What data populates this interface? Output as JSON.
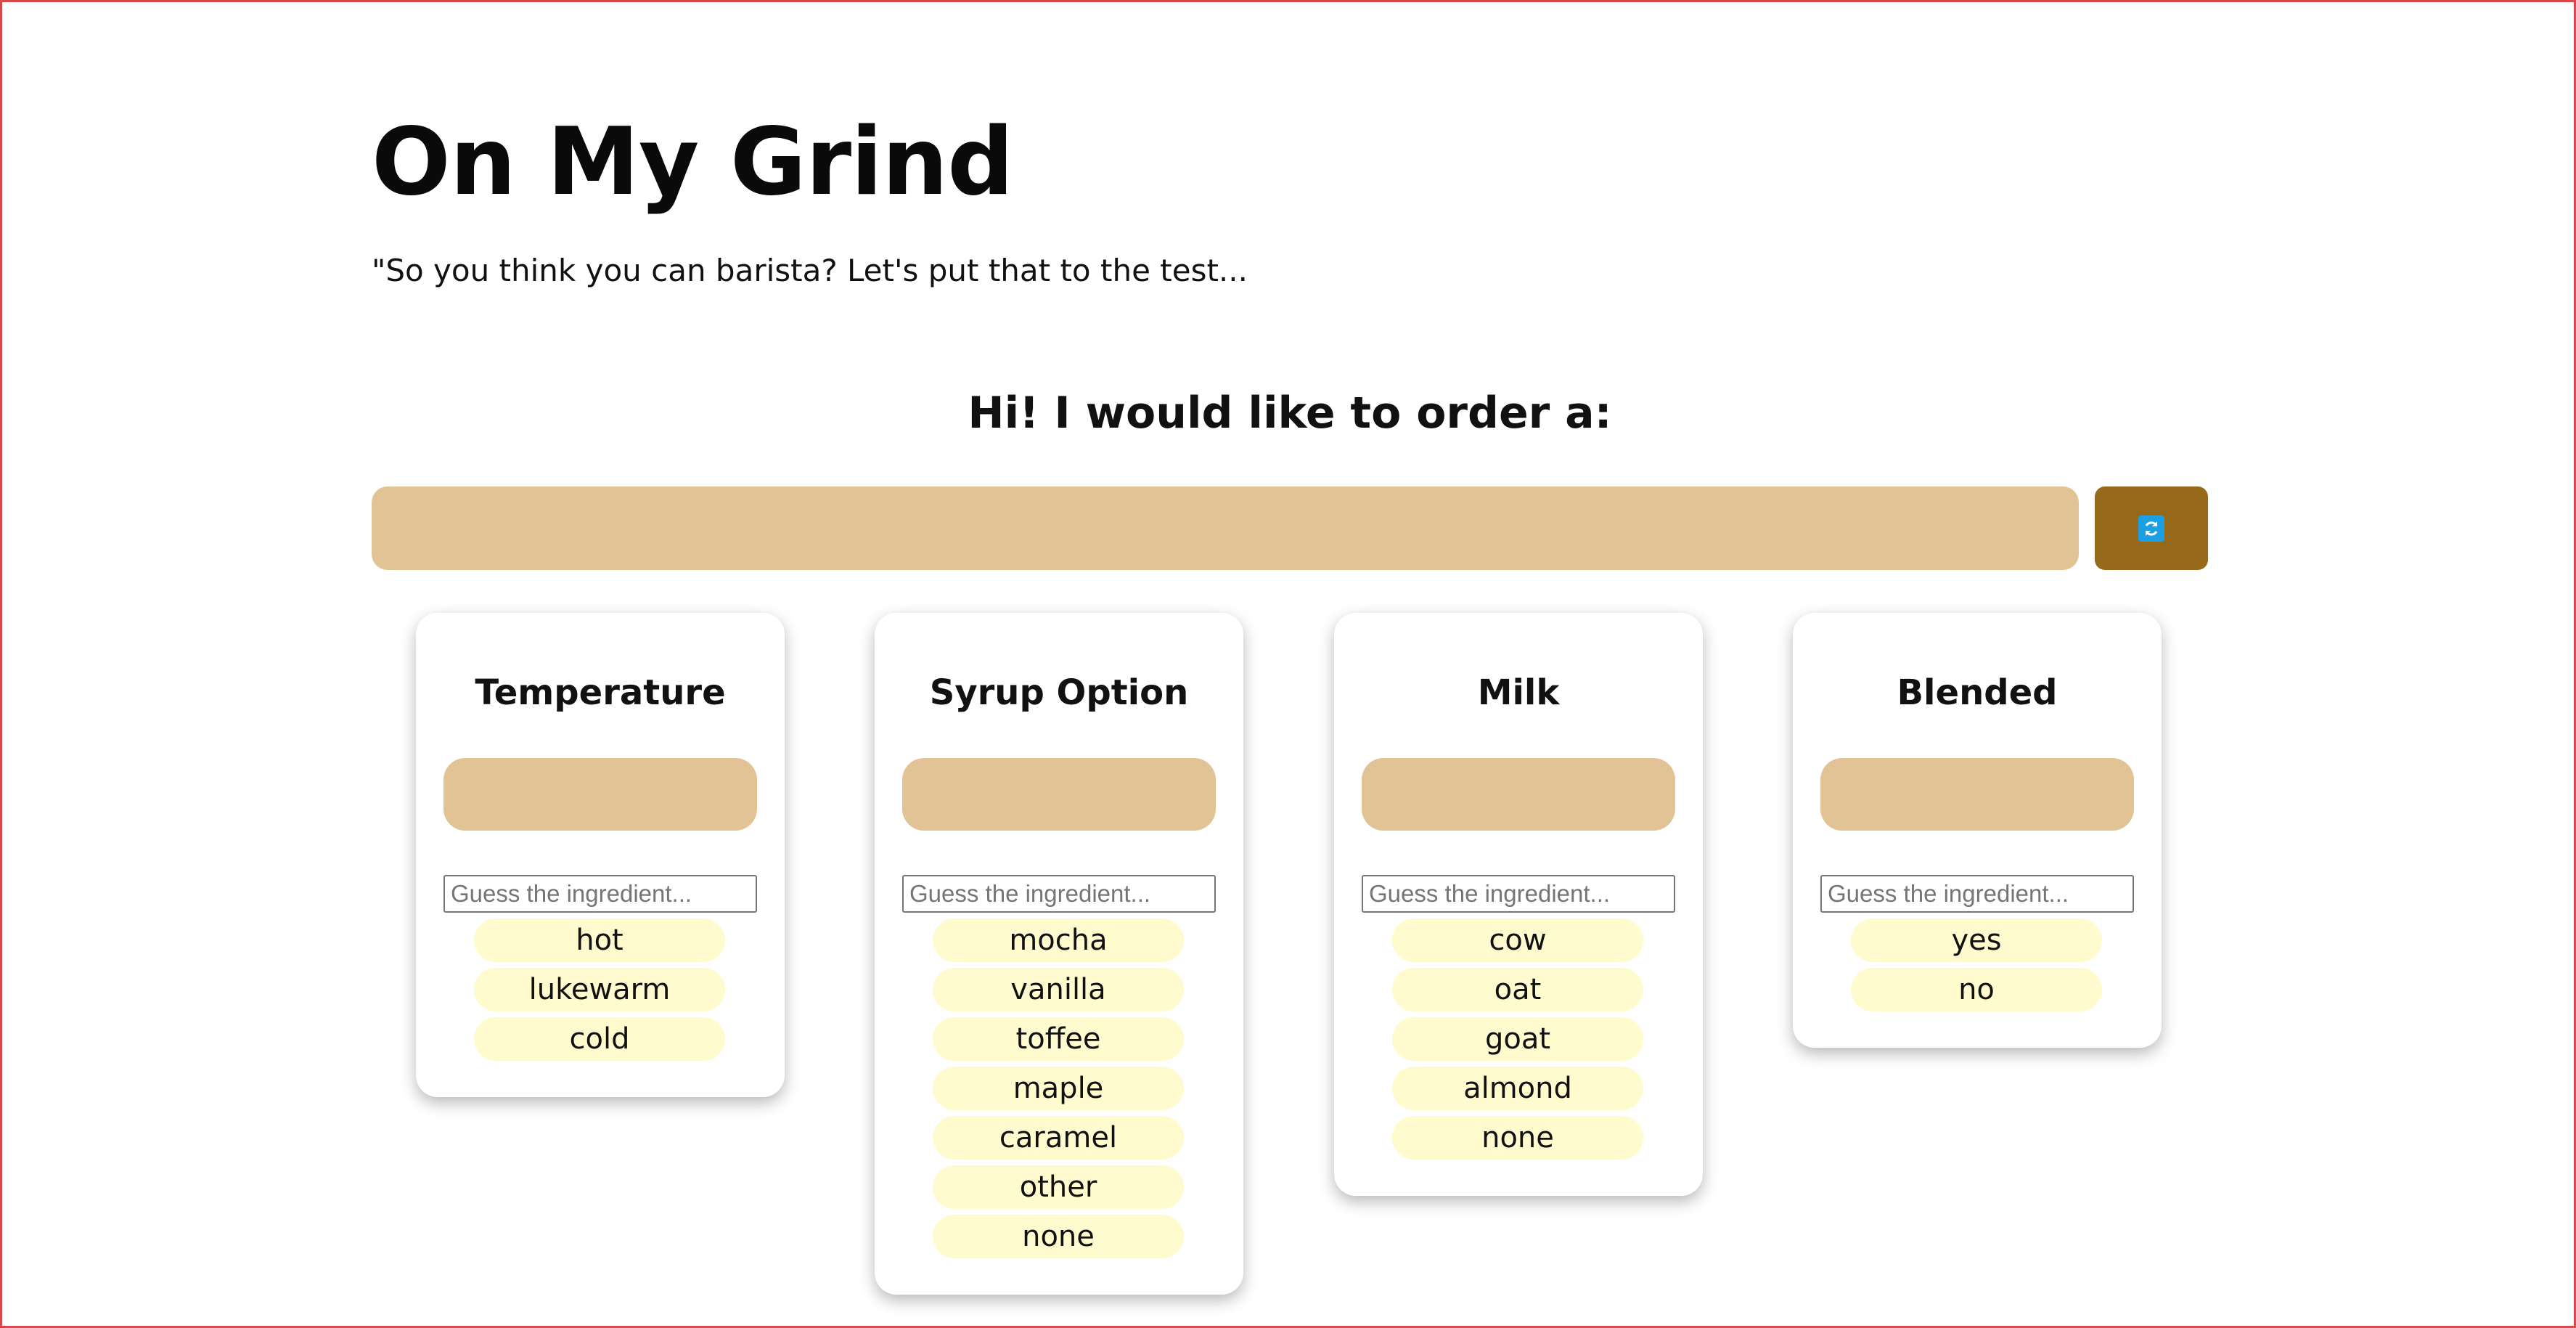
{
  "header": {
    "title": "On My Grind",
    "subtitle": "\"So you think you can barista? Let's put that to the test..."
  },
  "order": {
    "heading": "Hi! I would like to order a:",
    "current_order": "",
    "refresh_icon": "refresh-icon"
  },
  "colors": {
    "slot_tan": "#e1c396",
    "button_brown": "#97691b",
    "option_cream": "#fffbce",
    "icon_blue": "#1aa0e3"
  },
  "categories": [
    {
      "title": "Temperature",
      "answer": "",
      "input_placeholder": "Guess the ingredient...",
      "options": [
        "hot",
        "lukewarm",
        "cold"
      ]
    },
    {
      "title": "Syrup Option",
      "answer": "",
      "input_placeholder": "Guess the ingredient...",
      "options": [
        "mocha",
        "vanilla",
        "toffee",
        "maple",
        "caramel",
        "other",
        "none"
      ]
    },
    {
      "title": "Milk",
      "answer": "",
      "input_placeholder": "Guess the ingredient...",
      "options": [
        "cow",
        "oat",
        "goat",
        "almond",
        "none"
      ]
    },
    {
      "title": "Blended",
      "answer": "",
      "input_placeholder": "Guess the ingredient...",
      "options": [
        "yes",
        "no"
      ]
    }
  ]
}
